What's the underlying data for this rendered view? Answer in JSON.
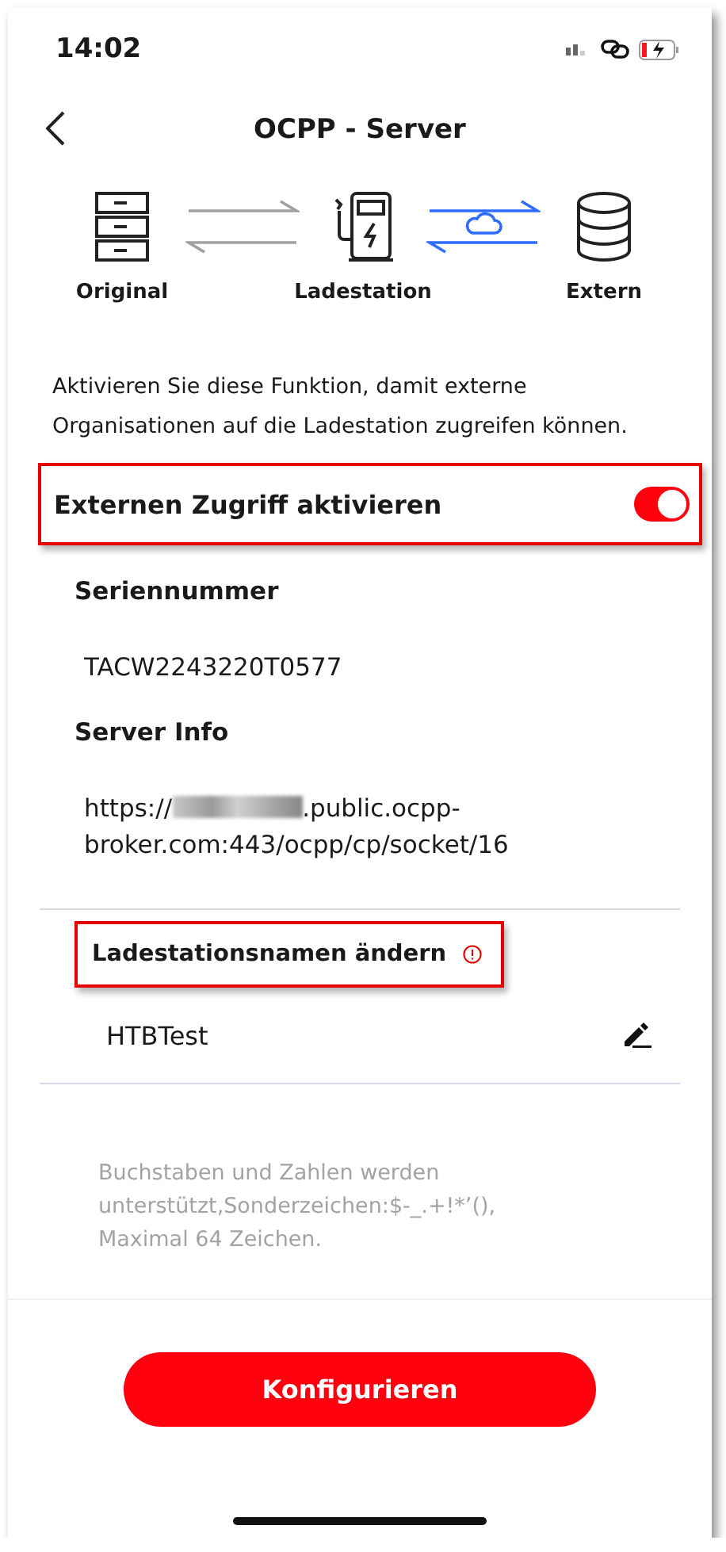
{
  "status_bar": {
    "time": "14:02"
  },
  "header": {
    "title": "OCPP - Server"
  },
  "diagram": {
    "nodes": [
      {
        "label": "Original",
        "kind": "server"
      },
      {
        "label": "Ladestation",
        "kind": "charger"
      },
      {
        "label": "Extern",
        "kind": "database"
      }
    ],
    "links": [
      {
        "kind": "plain"
      },
      {
        "kind": "cloud"
      }
    ]
  },
  "description": "Aktivieren Sie diese Funktion, damit externe Organisationen auf die Ladestation zugreifen können.",
  "external_access": {
    "label": "Externen Zugriff aktivieren",
    "on": true,
    "highlighted": true
  },
  "fields": [
    {
      "label": "Seriennummer",
      "value": "TACW2243220T0577"
    },
    {
      "label": "Server Info",
      "prefix": "https://",
      "redacted": true,
      "value_lines": [
        ".public.ocpp-",
        "broker.com:443/ocpp/cp/socket/16"
      ]
    }
  ],
  "name_section": {
    "label": "Ladestationsnamen ändern",
    "highlighted": true,
    "warning": true,
    "value": "HTBTest"
  },
  "hint": "Buchstaben und Zahlen werden unterstützt,Sonderzeichen:$-_.+!*’(), Maximal 64 Zeichen.",
  "button": "Konfigurieren"
}
